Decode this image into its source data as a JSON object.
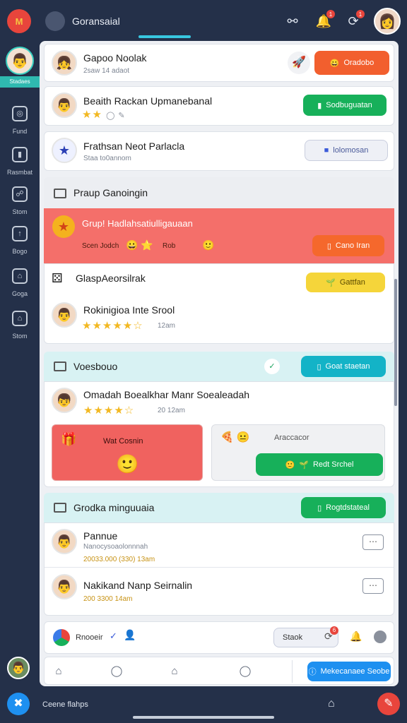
{
  "app": {
    "title": "Goransaial",
    "logo_text": "M",
    "accent": "#38c7e0",
    "topbar_bg": "#243049",
    "icons": [
      "user-search-icon",
      "bell-icon",
      "refresh-icon"
    ],
    "notif_badges": [
      "",
      "1",
      "1"
    ]
  },
  "sidebar": {
    "profile_label": "Stadaes",
    "items": [
      {
        "label": "Fund",
        "icon": "target-icon"
      },
      {
        "label": "Rasmbat",
        "icon": "video-icon"
      },
      {
        "label": "Stom",
        "icon": "shield-icon"
      },
      {
        "label": "Bogo",
        "icon": "upload-icon"
      },
      {
        "label": "Goga",
        "icon": "store-icon"
      },
      {
        "label": "Stom",
        "icon": "home-icon"
      }
    ]
  },
  "feed": {
    "top_cards": [
      {
        "name": "Gapoo Noolak",
        "meta": "2saw    14 adaot",
        "button": "Oradobo"
      },
      {
        "name": "Beaith Rackan Upmanebanal",
        "meta": "",
        "button": "Sodbuguatan"
      },
      {
        "name": "Frathsan Neot Parlacla",
        "meta": "Staa    to0annom",
        "button": "lolomosan"
      }
    ],
    "group_section": {
      "title": "Praup Ganoingin",
      "highlight": {
        "title": "Grup! Hadlahsatiulligauaan",
        "meta_left": "Scen Jodch",
        "meta_right": "Rob",
        "button": "Cano Iran"
      },
      "rows": [
        {
          "name": "GlaspAeorsilrak",
          "button": "Gattfan"
        },
        {
          "name": "Rokinigioa Inte Srool",
          "meta": "12am"
        }
      ]
    },
    "voucher_section": {
      "title": "Voesbouo",
      "button": "Goat staetan",
      "row": {
        "name": "Omadah Boealkhar Manr Soealeadah",
        "meta": "20   12am"
      },
      "promo_left": "Wat Cosnin",
      "promo_right_label": "Araccacor",
      "promo_right_button": "Redt Srchel"
    },
    "group_section_2": {
      "title": "Grodka minguuaia",
      "button": "Rogtdstateal",
      "rows": [
        {
          "name": "Pannue",
          "sub": "Nanocysoaolonnnah",
          "meta": "20033.000    (330)    13am"
        },
        {
          "name": "Nakikand Nanp Seirnalin",
          "meta": "200    3300    14am"
        }
      ]
    },
    "share_bar": {
      "label": "Rnooeir",
      "button": "Staok",
      "badge": "6"
    }
  },
  "bottom_tabs": {
    "cta": "Mekecanaee  Seobe"
  },
  "footer": {
    "label": "Ceene flahps"
  }
}
